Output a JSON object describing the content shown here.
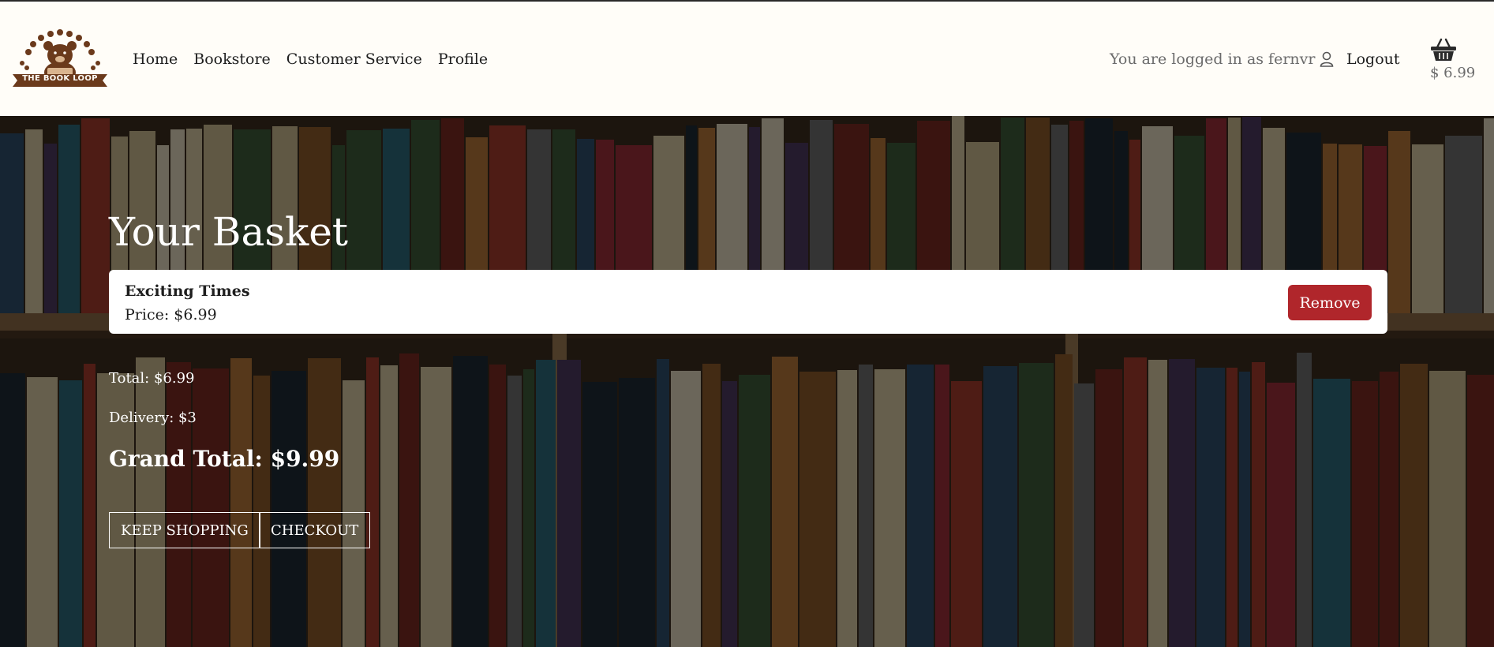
{
  "brand": {
    "logo_text": "THE BOOK LOOP"
  },
  "nav": [
    {
      "label": "Home"
    },
    {
      "label": "Bookstore"
    },
    {
      "label": "Customer Service"
    },
    {
      "label": "Profile"
    }
  ],
  "account": {
    "status_text": "You are logged in as fernvr",
    "logout_label": "Logout"
  },
  "basket_widget": {
    "total": "$ 6.99"
  },
  "page": {
    "title": "Your Basket",
    "items": [
      {
        "title": "Exciting Times",
        "price": "Price: $6.99",
        "remove_label": "Remove"
      }
    ],
    "total": "Total: $6.99",
    "delivery": "Delivery: $3",
    "grand_total": "Grand Total: $9.99",
    "keep_shopping_label": "KEEP SHOPPING",
    "checkout_label": "CHECKOUT"
  },
  "colors": {
    "header_bg": "#fffdf8",
    "remove_button": "#b0262b",
    "logo_brown": "#6b3a1c"
  }
}
